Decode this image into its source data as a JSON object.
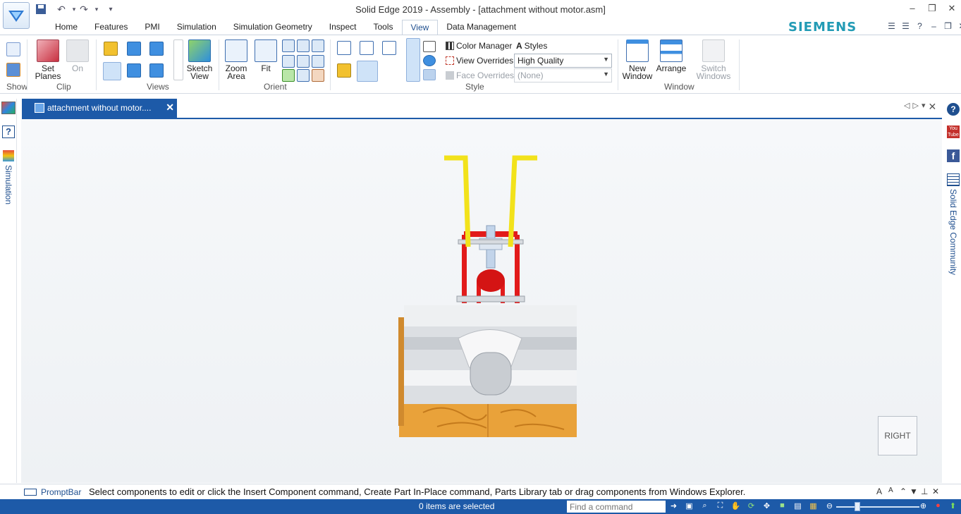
{
  "window": {
    "title": "Solid Edge 2019 - Assembly - [attachment without motor.asm]",
    "minimize": "–",
    "restore": "❐",
    "close": "✕"
  },
  "quick_access": {
    "save_icon": "save-icon",
    "undo_icon": "undo-icon",
    "redo_icon": "redo-icon",
    "customize_icon": "chevron-down-icon"
  },
  "ribbon_tabs": [
    "Home",
    "Features",
    "PMI",
    "Simulation",
    "Simulation Geometry",
    "Inspect",
    "Tools",
    "View",
    "Data Management"
  ],
  "active_tab": "View",
  "brand": "SIEMENS",
  "ribbon": {
    "show_label": "Show",
    "set_planes": "Set\nPlanes",
    "on": "On",
    "clip_label": "Clip",
    "views_label": "Views",
    "sketch_view": "Sketch\nView",
    "zoom_area": "Zoom\nArea",
    "fit": "Fit",
    "orient_label": "Orient",
    "color_manager": "Color Manager",
    "styles": "Styles",
    "view_overrides": "View Overrides",
    "face_overrides": "Face Overrides",
    "quality_value": "High Quality",
    "face_override_value": "(None)",
    "style_label": "Style",
    "new_window": "New\nWindow",
    "arrange": "Arrange",
    "switch_windows": "Switch\nWindows",
    "window_label": "Window"
  },
  "document_tab": {
    "label": "attachment without motor....",
    "close": "✕"
  },
  "left_panel": {
    "simulation_label": "Simulation"
  },
  "right_panel": {
    "community_label": "Solid Edge Community"
  },
  "viewport": {
    "view_cube_label": "RIGHT"
  },
  "prompt_bar": {
    "label": "PromptBar",
    "message": "Select components to edit or click the Insert Component command, Create Part In-Place command, Parts Library tab or drag components from Windows Explorer."
  },
  "status_bar": {
    "selection_text": "0 items are selected",
    "find_placeholder": "Find a command"
  },
  "colors": {
    "accent_blue": "#1d5aa8",
    "siemens_teal": "#229bb5",
    "model_red": "#e21b1b",
    "model_yellow": "#f2e21b",
    "wood": "#e9a23a"
  }
}
